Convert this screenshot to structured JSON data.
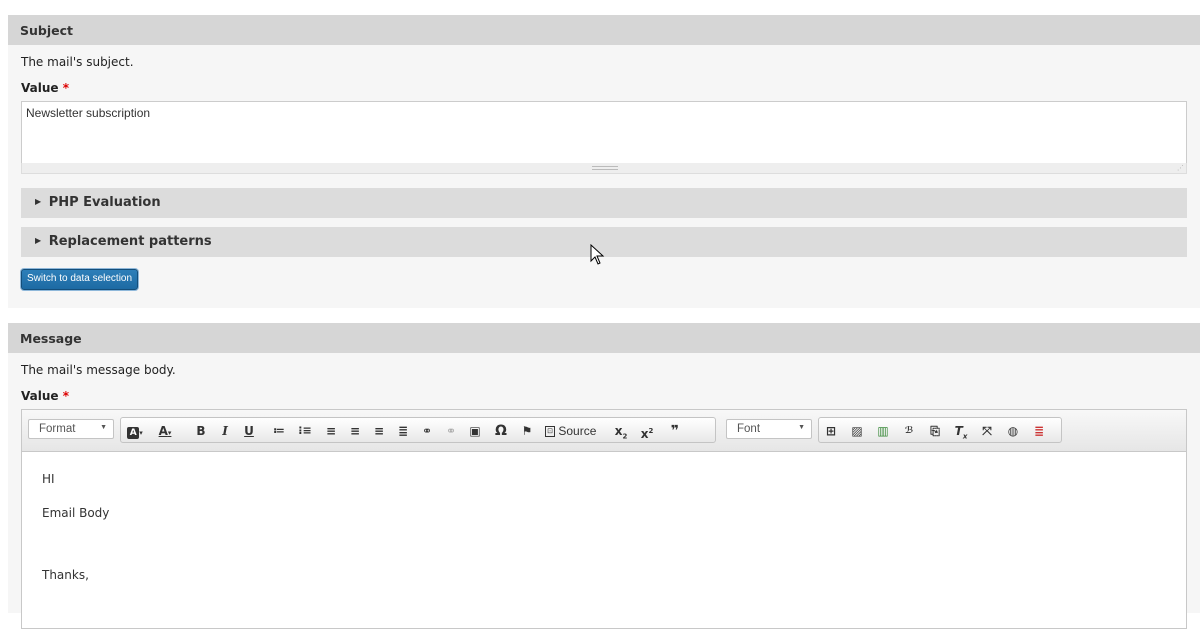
{
  "subject": {
    "legend": "Subject",
    "description": "The mail's subject.",
    "value_label": "Value",
    "required_mark": "*",
    "value": "Newsletter subscription",
    "php_evaluation": "PHP Evaluation",
    "replacement_patterns": "Replacement patterns",
    "switch_button": "Switch to data selection"
  },
  "message": {
    "legend": "Message",
    "description": "The mail's message body.",
    "value_label": "Value",
    "required_mark": "*",
    "toolbar": {
      "format": "Format",
      "source": "Source",
      "font": "Font"
    },
    "body": [
      "HI",
      "Email Body",
      "Thanks,"
    ]
  },
  "colors": {
    "accent": "#1d6aa3",
    "legend_bg": "#d6d6d6",
    "required": "#dd0000"
  }
}
